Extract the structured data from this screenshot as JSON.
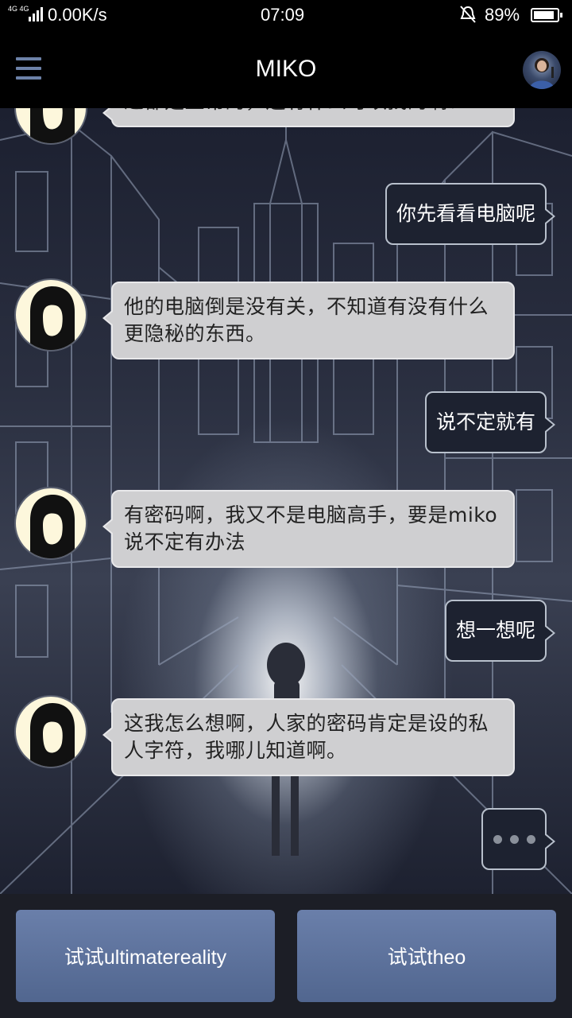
{
  "status_bar": {
    "network_type": "4G 4G",
    "speed": "0.00K/s",
    "time": "07:09",
    "battery_percent": "89%",
    "battery_level": 0.89,
    "icons": [
      "signal-icon",
      "mute-icon",
      "battery-icon"
    ]
  },
  "app_bar": {
    "title": "MIKO",
    "menu_icon": "hamburger-menu-icon",
    "avatar_icon": "profile-avatar"
  },
  "messages": [
    {
      "from": "them",
      "text": "过都是正常的，还有什么可以找的啊？"
    },
    {
      "from": "me",
      "text": "你先看看电脑呢"
    },
    {
      "from": "them",
      "text": "他的电脑倒是没有关，不知道有没有什么更隐秘的东西。"
    },
    {
      "from": "me",
      "text": "说不定就有"
    },
    {
      "from": "them",
      "text": "有密码啊，我又不是电脑高手，要是miko说不定有办法"
    },
    {
      "from": "me",
      "text": "想一想呢"
    },
    {
      "from": "them",
      "text": "这我怎么想啊，人家的密码肯定是设的私人字符，我哪儿知道啊。"
    },
    {
      "from": "me",
      "typing": true
    }
  ],
  "choices": [
    {
      "label": "试试ultimatereality"
    },
    {
      "label": "试试theo"
    }
  ],
  "colors": {
    "accent": "#6d82a8",
    "choice_button": "#5a6f99",
    "incoming_bubble": "#cfcfd1",
    "outgoing_bubble": "#1d2230"
  }
}
